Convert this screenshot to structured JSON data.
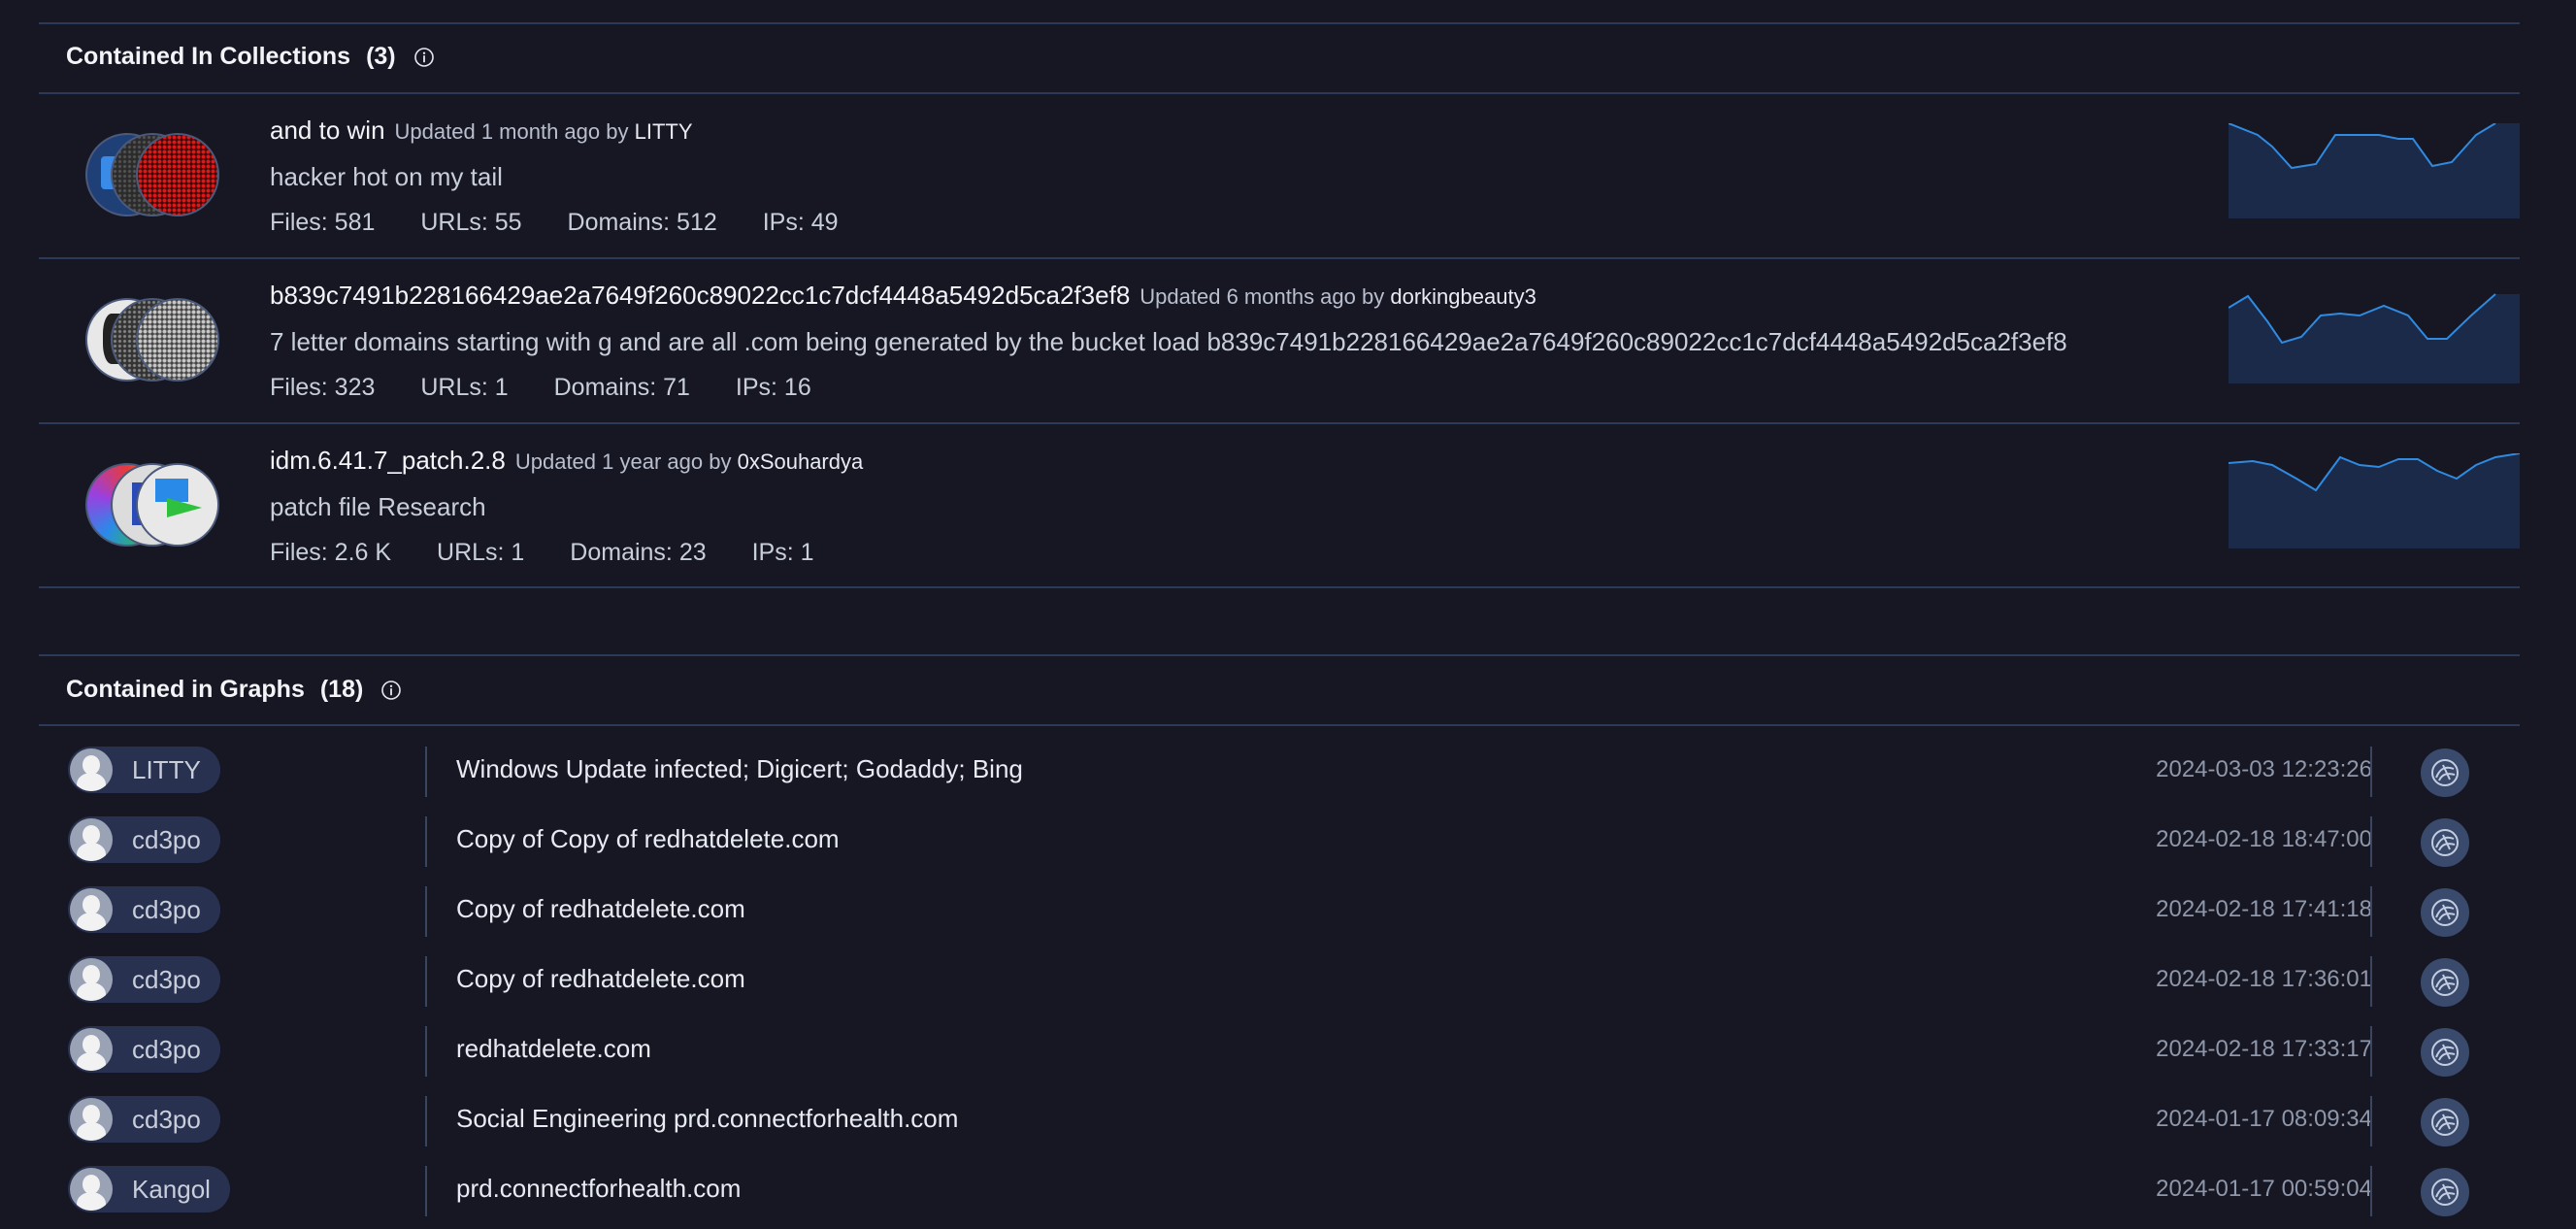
{
  "collections_section": {
    "title": "Contained In Collections",
    "count": "(3)",
    "items": [
      {
        "name": "and to win",
        "updated": "Updated 1 month ago by",
        "author": "LITTY",
        "description": "hacker hot on my tail",
        "files": "Files: 581",
        "urls": "URLs: 55",
        "domains": "Domains: 512",
        "ips": "IPs: 49"
      },
      {
        "name": "b839c7491b228166429ae2a7649f260c89022cc1c7dcf4448a5492d5ca2f3ef8",
        "updated": "Updated 6 months ago by",
        "author": "dorkingbeauty3",
        "description": "7 letter domains starting with g and are all .com being generated by the bucket load b839c7491b228166429ae2a7649f260c89022cc1c7dcf4448a5492d5ca2f3ef8",
        "files": "Files: 323",
        "urls": "URLs: 1",
        "domains": "Domains: 71",
        "ips": "IPs: 16"
      },
      {
        "name": "idm.6.41.7_patch.2.8",
        "updated": "Updated 1 year ago by",
        "author": "0xSouhardya",
        "description": "patch file Research",
        "files": "Files: 2.6 K",
        "urls": "URLs: 1",
        "domains": "Domains: 23",
        "ips": "IPs: 1"
      }
    ]
  },
  "graphs_section": {
    "title": "Contained in Graphs",
    "count": "(18)",
    "items": [
      {
        "user": "LITTY",
        "title": "Windows Update infected; Digicert; Godaddy; Bing",
        "date": "2024-03-03 12:23:26"
      },
      {
        "user": "cd3po",
        "title": "Copy of Copy of redhatdelete.com",
        "date": "2024-02-18 18:47:00"
      },
      {
        "user": "cd3po",
        "title": "Copy of redhatdelete.com",
        "date": "2024-02-18 17:41:18"
      },
      {
        "user": "cd3po",
        "title": "Copy of redhatdelete.com",
        "date": "2024-02-18 17:36:01"
      },
      {
        "user": "cd3po",
        "title": "redhatdelete.com",
        "date": "2024-02-18 17:33:17"
      },
      {
        "user": "cd3po",
        "title": "Social Engineering prd.connectforhealth.com",
        "date": "2024-01-17 08:09:34"
      },
      {
        "user": "Kangol",
        "title": "prd.connectforhealth.com",
        "date": "2024-01-17 00:59:04"
      }
    ]
  },
  "colors": {
    "background": "#161723",
    "divider": "#2a3a58",
    "sparkline_line": "#2f8ae0",
    "sparkline_fill": "#1a2a48",
    "pill": "#283250"
  }
}
